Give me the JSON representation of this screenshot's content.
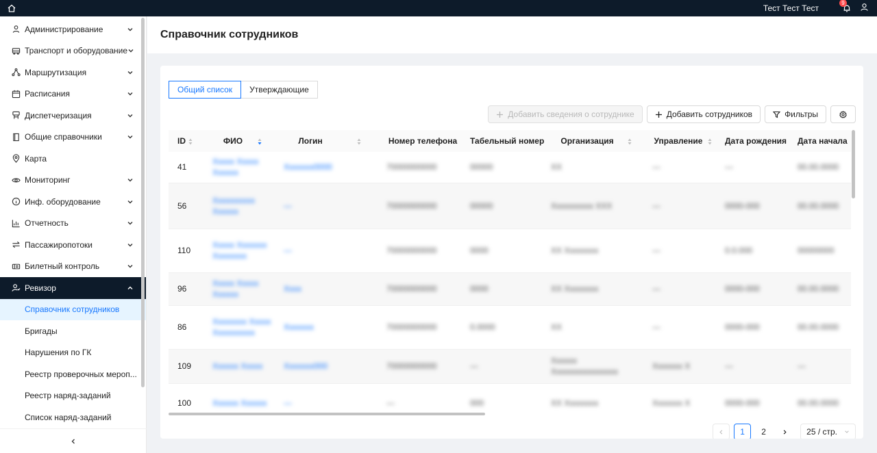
{
  "topbar": {
    "username": "Тест Тест Тест",
    "notification_count": "9"
  },
  "sidebar": {
    "items": [
      {
        "label": "Администрирование",
        "icon": "user-icon"
      },
      {
        "label": "Транспорт и оборудование",
        "icon": "truck-icon"
      },
      {
        "label": "Маршрутизация",
        "icon": "route-icon"
      },
      {
        "label": "Расписания",
        "icon": "calendar-icon"
      },
      {
        "label": "Диспетчеризация",
        "icon": "dispatch-icon"
      },
      {
        "label": "Общие справочники",
        "icon": "book-icon"
      },
      {
        "label": "Карта",
        "icon": "map-pin-icon"
      },
      {
        "label": "Мониторинг",
        "icon": "eye-icon"
      },
      {
        "label": "Инф. оборудование",
        "icon": "info-icon"
      },
      {
        "label": "Отчетность",
        "icon": "bar-chart-icon"
      },
      {
        "label": "Пассажиропотоки",
        "icon": "swap-icon"
      },
      {
        "label": "Билетный контроль",
        "icon": "ticket-icon"
      },
      {
        "label": "Ревизор",
        "icon": "inspector-icon"
      }
    ],
    "sub_items": [
      "Справочник сотрудников",
      "Бригады",
      "Нарушения по ГК",
      "Реестр проверочных мероп...",
      "Реестр наряд-заданий",
      "Список наряд-заданий"
    ]
  },
  "page": {
    "title": "Справочник сотрудников"
  },
  "tabs": [
    "Общий список",
    "Утверждающие"
  ],
  "toolbar": {
    "add_info": "Добавить сведения о сотруднике",
    "add_employees": "Добавить сотрудников",
    "filters": "Фильтры"
  },
  "table": {
    "columns": [
      "ID",
      "ФИО",
      "Логин",
      "Номер телефона",
      "Табельный номер",
      "Организация",
      "Управление",
      "Дата рождения",
      "Дата начала"
    ],
    "rows": [
      {
        "id": "41",
        "fio": "Xxxxx Xxxxx Xxxxxx",
        "login": "Xxxxxxx0000",
        "phone": "70000000000",
        "tab": "00000",
        "org": "XX",
        "dept": "—",
        "dob": "—",
        "start": "00.00.0000"
      },
      {
        "id": "56",
        "fio": "Xxxxxxxxxx Xxxxxx",
        "login": "—",
        "phone": "70000000000",
        "tab": "00000",
        "org": "Xxxxxxxxxx XXX",
        "dept": "—",
        "dob": "0000-000",
        "start": "00.00.0000"
      },
      {
        "id": "110",
        "fio": "Xxxxx Xxxxxxx Xxxxxxxx",
        "login": "—",
        "phone": "70000000000",
        "tab": "0000",
        "org": "XX Xxxxxxxx",
        "dept": "—",
        "dob": "0.0.000",
        "start": "00000000"
      },
      {
        "id": "96",
        "fio": "Xxxxx Xxxxx Xxxxxx",
        "login": "Xxxx",
        "phone": "70000000000",
        "tab": "0000",
        "org": "XX Xxxxxxxx",
        "dept": "—",
        "dob": "0000-000",
        "start": "00.00.0000"
      },
      {
        "id": "86",
        "fio": "Xxxxxxxx Xxxxx Xxxxxxxxxx",
        "login": "Xxxxxxx",
        "phone": "70000000000",
        "tab": "0.0000",
        "org": "XX",
        "dept": "—",
        "dob": "0000-000",
        "start": "00.00.0000"
      },
      {
        "id": "109",
        "fio": "Xxxxxx Xxxxx",
        "login": "Xxxxxxx000",
        "phone": "70000000000",
        "tab": "—",
        "org": "Xxxxxx Xxxxxxxxxxxxxxxx",
        "dept": "Xxxxxxx X",
        "dob": "—",
        "start": "—"
      },
      {
        "id": "100",
        "fio": "Xxxxxx Xxxxxx",
        "login": "—",
        "phone": "—",
        "tab": "000",
        "org": "XX Xxxxxxxx",
        "dept": "Xxxxxxx X",
        "dob": "0000-000",
        "start": "00.00.0000"
      }
    ]
  },
  "pagination": {
    "pages": [
      "1",
      "2"
    ],
    "current": "1",
    "page_size": "25 / стр."
  }
}
